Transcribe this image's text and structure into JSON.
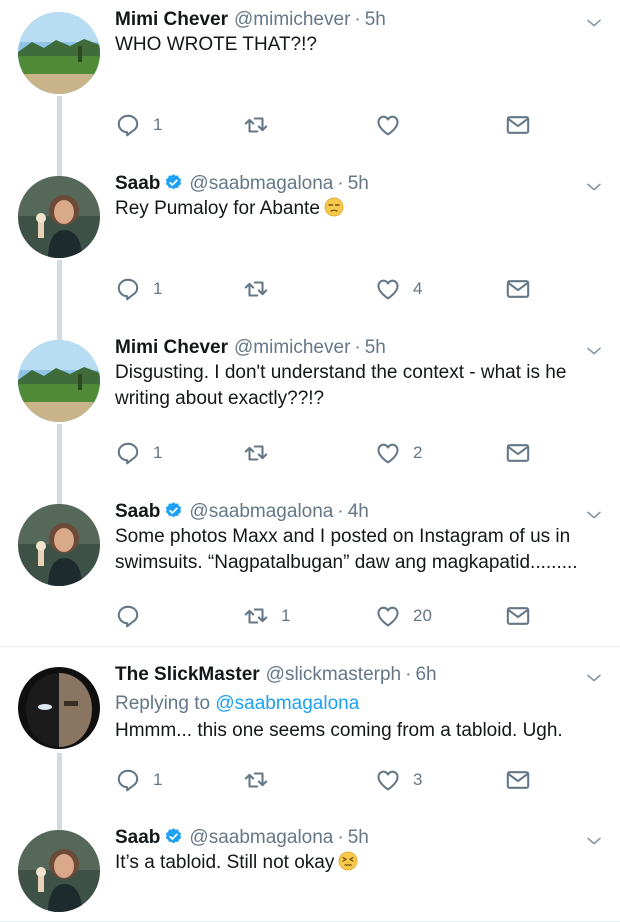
{
  "tweets": [
    {
      "name": "Mimi Chever",
      "handle": "@mimichever",
      "dot": "·",
      "time": "5h",
      "text": "WHO WROTE THAT?!?",
      "replies": "1",
      "retweets": "",
      "likes": "",
      "verified": false,
      "avatar": "landscape"
    },
    {
      "name": "Saab",
      "handle": "@saabmagalona",
      "dot": "·",
      "time": "5h",
      "text": "Rey Pumaloy for Abante",
      "emoji": "unamused-face",
      "replies": "1",
      "retweets": "",
      "likes": "4",
      "verified": true,
      "avatar": "person"
    },
    {
      "name": "Mimi Chever",
      "handle": "@mimichever",
      "dot": "·",
      "time": "5h",
      "text": "Disgusting. I don't understand the context - what is he writing about exactly??!?",
      "replies": "1",
      "retweets": "",
      "likes": "2",
      "verified": false,
      "avatar": "landscape"
    },
    {
      "name": "Saab",
      "handle": "@saabmagalona",
      "dot": "·",
      "time": "4h",
      "text": "Some photos Maxx and I posted on Instagram of us in swimsuits. “Nagpatalbugan” daw ang magkapatid.........",
      "replies": "",
      "retweets": "1",
      "likes": "20",
      "verified": true,
      "avatar": "person"
    },
    {
      "name": "The SlickMaster",
      "handle": "@slickmasterph",
      "dot": "·",
      "time": "6h",
      "replying_prefix": "Replying to",
      "replying_to": "@saabmagalona",
      "text": "Hmmm... this one seems coming from a tabloid. Ugh.",
      "replies": "1",
      "retweets": "",
      "likes": "3",
      "verified": false,
      "avatar": "masked"
    },
    {
      "name": "Saab",
      "handle": "@saabmagalona",
      "dot": "·",
      "time": "5h",
      "text": "It’s a tabloid. Still not okay",
      "emoji": "persevering-face",
      "replies": "",
      "retweets": "",
      "likes": "",
      "verified": true,
      "avatar": "person"
    }
  ],
  "colors": {
    "text": "#14171a",
    "muted": "#657786",
    "verified": "#1da1f2",
    "mention": "#1da1f2",
    "thread_line": "#d4dbe0",
    "divider": "#e6ecf0"
  },
  "icons": [
    "reply-icon",
    "retweet-icon",
    "like-icon",
    "direct-message-icon",
    "chevron-down-icon",
    "verified-badge-icon"
  ]
}
